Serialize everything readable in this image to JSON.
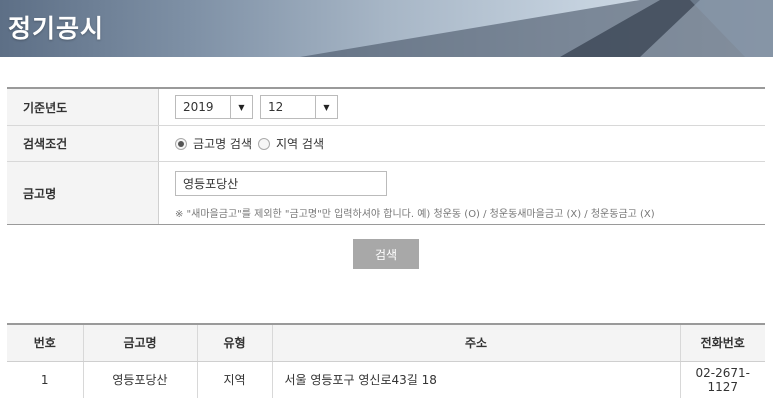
{
  "banner": {
    "title": "정기공시"
  },
  "form": {
    "year_label": "기준년도",
    "year_value": "2019",
    "month_value": "12",
    "condition_label": "검색조건",
    "condition_options": [
      {
        "label": "금고명 검색",
        "selected": true
      },
      {
        "label": "지역 검색",
        "selected": false
      }
    ],
    "name_label": "금고명",
    "name_value": "영등포당산",
    "hint": "※ \"새마을금고\"를 제외한 \"금고명\"만 입력하셔야 합니다. 예) 청운동 (O) / 청운동새마을금고 (X) / 청운동금고 (X)",
    "search_label": "검색"
  },
  "results": {
    "headers": [
      "번호",
      "금고명",
      "유형",
      "주소",
      "전화번호"
    ],
    "rows": [
      {
        "no": "1",
        "name": "영등포당산",
        "type": "지역",
        "address": "서울 영등포구 영신로43길 18",
        "phone": "02-2671-1127"
      }
    ]
  },
  "colors": {
    "button": "#a8a8a8",
    "label_bg": "#f4f4f4",
    "border": "#9a9a9a"
  },
  "icons": {
    "dropdown": "chevron-down-icon",
    "radio": "radio-icon"
  }
}
